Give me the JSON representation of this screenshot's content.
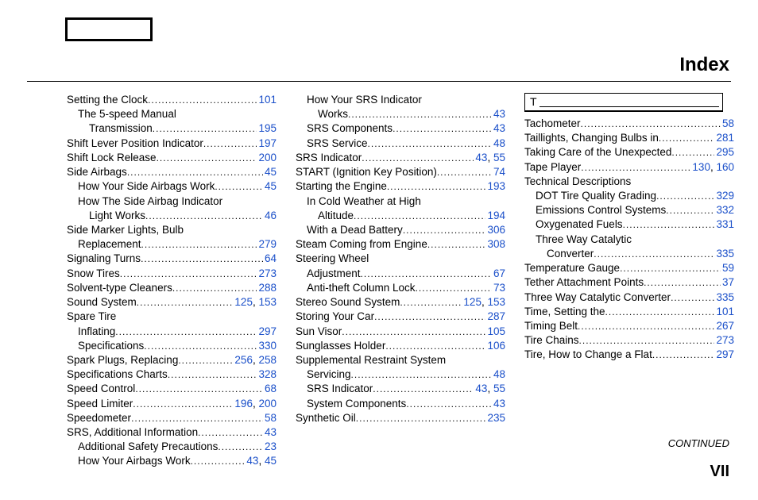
{
  "title": "Index",
  "continued": "CONTINUED",
  "pagenum": "VII",
  "section_letter": "T",
  "col1": [
    {
      "label": "Setting the Clock",
      "pages": [
        "101"
      ],
      "indent": 0
    },
    {
      "label": "The 5-speed Manual",
      "pages": [],
      "indent": 1,
      "nodots": true
    },
    {
      "label": "Transmission",
      "pages": [
        "195"
      ],
      "indent": 2
    },
    {
      "label": "Shift Lever Position Indicator",
      "pages": [
        "197"
      ],
      "indent": 0
    },
    {
      "label": "Shift Lock Release",
      "pages": [
        "200"
      ],
      "indent": 0
    },
    {
      "label": "Side Airbags",
      "pages": [
        "45"
      ],
      "indent": 0
    },
    {
      "label": "How Your Side Airbags Work",
      "pages": [
        "45"
      ],
      "indent": 1
    },
    {
      "label": "How The Side Airbag Indicator",
      "pages": [],
      "indent": 1,
      "nodots": true
    },
    {
      "label": "Light Works",
      "pages": [
        "46"
      ],
      "indent": 2
    },
    {
      "label": "Side Marker Lights, Bulb",
      "pages": [],
      "indent": 0,
      "nodots": true
    },
    {
      "label": "Replacement",
      "pages": [
        "279"
      ],
      "indent": 1
    },
    {
      "label": "Signaling Turns",
      "pages": [
        "64"
      ],
      "indent": 0
    },
    {
      "label": "Snow Tires",
      "pages": [
        "273"
      ],
      "indent": 0
    },
    {
      "label": "Solvent-type Cleaners",
      "pages": [
        "288"
      ],
      "indent": 0
    },
    {
      "label": "Sound System",
      "pages": [
        "125",
        "153"
      ],
      "indent": 0
    },
    {
      "label": "Spare Tire",
      "pages": [],
      "indent": 0,
      "nodots": true
    },
    {
      "label": "Inflating",
      "pages": [
        "297"
      ],
      "indent": 1
    },
    {
      "label": "Specifications",
      "pages": [
        "330"
      ],
      "indent": 1
    },
    {
      "label": "Spark Plugs, Replacing",
      "pages": [
        "256",
        "258"
      ],
      "indent": 0
    },
    {
      "label": "Specifications Charts",
      "pages": [
        "328"
      ],
      "indent": 0
    },
    {
      "label": "Speed Control",
      "pages": [
        "68"
      ],
      "indent": 0
    },
    {
      "label": "Speed Limiter",
      "pages": [
        "196",
        "200"
      ],
      "indent": 0
    },
    {
      "label": "Speedometer",
      "pages": [
        "58"
      ],
      "indent": 0
    },
    {
      "label": "SRS, Additional Information",
      "pages": [
        "43"
      ],
      "indent": 0
    },
    {
      "label": "Additional Safety Precautions",
      "pages": [
        "23"
      ],
      "indent": 1
    },
    {
      "label": "How Your Airbags Work",
      "pages": [
        "43",
        "45"
      ],
      "indent": 1
    }
  ],
  "col2": [
    {
      "label": "How Your SRS Indicator",
      "pages": [],
      "indent": 1,
      "nodots": true
    },
    {
      "label": "Works",
      "pages": [
        "43"
      ],
      "indent": 2
    },
    {
      "label": "SRS Components",
      "pages": [
        "43"
      ],
      "indent": 1
    },
    {
      "label": "SRS Service",
      "pages": [
        "48"
      ],
      "indent": 1
    },
    {
      "label": "SRS Indicator",
      "pages": [
        "43",
        "55"
      ],
      "indent": 0
    },
    {
      "label": "START (Ignition Key Position)",
      "pages": [
        "74"
      ],
      "indent": 0
    },
    {
      "label": "Starting the Engine",
      "pages": [
        "193"
      ],
      "indent": 0
    },
    {
      "label": "In Cold Weather at High",
      "pages": [],
      "indent": 1,
      "nodots": true
    },
    {
      "label": "Altitude",
      "pages": [
        "194"
      ],
      "indent": 2
    },
    {
      "label": "With a Dead Battery",
      "pages": [
        "306"
      ],
      "indent": 1
    },
    {
      "label": "Steam Coming from Engine",
      "pages": [
        "308"
      ],
      "indent": 0
    },
    {
      "label": "Steering Wheel",
      "pages": [],
      "indent": 0,
      "nodots": true
    },
    {
      "label": "Adjustment",
      "pages": [
        "67"
      ],
      "indent": 1
    },
    {
      "label": "Anti-theft Column Lock",
      "pages": [
        "73"
      ],
      "indent": 1
    },
    {
      "label": "Stereo Sound System",
      "pages": [
        "125",
        "153"
      ],
      "indent": 0
    },
    {
      "label": "Storing Your Car",
      "pages": [
        "287"
      ],
      "indent": 0
    },
    {
      "label": "Sun Visor",
      "pages": [
        "105"
      ],
      "indent": 0
    },
    {
      "label": "Sunglasses Holder",
      "pages": [
        "106"
      ],
      "indent": 0
    },
    {
      "label": "Supplemental Restraint System",
      "pages": [],
      "indent": 0,
      "nodots": true
    },
    {
      "label": "Servicing",
      "pages": [
        "48"
      ],
      "indent": 1
    },
    {
      "label": "SRS Indicator",
      "pages": [
        "43",
        "55"
      ],
      "indent": 1
    },
    {
      "label": "System Components",
      "pages": [
        "43"
      ],
      "indent": 1
    },
    {
      "label": "Synthetic Oil",
      "pages": [
        "235"
      ],
      "indent": 0
    }
  ],
  "col3": [
    {
      "label": "Tachometer",
      "pages": [
        "58"
      ],
      "indent": 0
    },
    {
      "label": "Taillights, Changing Bulbs in",
      "pages": [
        "281"
      ],
      "indent": 0
    },
    {
      "label": "Taking Care of the Unexpected",
      "pages": [
        "295"
      ],
      "indent": 0
    },
    {
      "label": "Tape Player",
      "pages": [
        "130",
        "160"
      ],
      "indent": 0
    },
    {
      "label": "Technical Descriptions",
      "pages": [],
      "indent": 0,
      "nodots": true
    },
    {
      "label": "DOT Tire Quality Grading",
      "pages": [
        "329"
      ],
      "indent": 1
    },
    {
      "label": "Emissions Control Systems",
      "pages": [
        "332"
      ],
      "indent": 1
    },
    {
      "label": "Oxygenated Fuels",
      "pages": [
        "331"
      ],
      "indent": 1
    },
    {
      "label": "Three Way Catalytic",
      "pages": [],
      "indent": 1,
      "nodots": true
    },
    {
      "label": "Converter",
      "pages": [
        "335"
      ],
      "indent": 2
    },
    {
      "label": "Temperature Gauge",
      "pages": [
        "59"
      ],
      "indent": 0
    },
    {
      "label": "Tether Attachment Points",
      "pages": [
        "37"
      ],
      "indent": 0
    },
    {
      "label": "Three Way Catalytic Converter",
      "pages": [
        "335"
      ],
      "indent": 0
    },
    {
      "label": "Time, Setting the",
      "pages": [
        "101"
      ],
      "indent": 0
    },
    {
      "label": "Timing Belt",
      "pages": [
        "267"
      ],
      "indent": 0
    },
    {
      "label": "Tire Chains",
      "pages": [
        "273"
      ],
      "indent": 0
    },
    {
      "label": "Tire, How to Change a Flat",
      "pages": [
        "297"
      ],
      "indent": 0
    }
  ]
}
